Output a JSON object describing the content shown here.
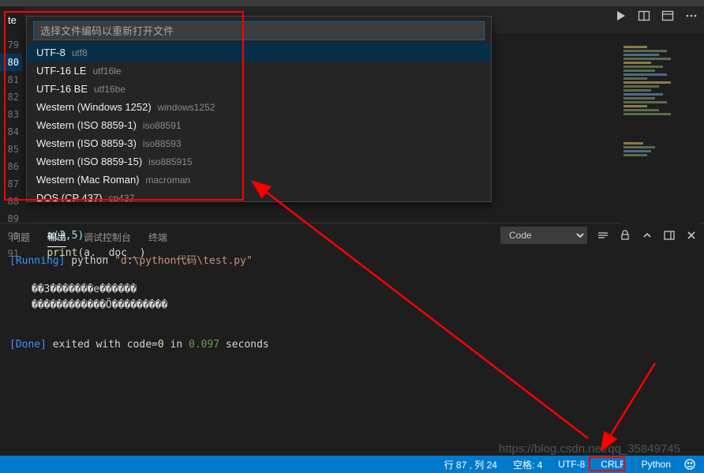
{
  "tab": {
    "label": "te"
  },
  "quick_input": {
    "placeholder": "选择文件编码以重新打开文件",
    "items": [
      {
        "label": "UTF-8",
        "sub": "utf8",
        "selected": true
      },
      {
        "label": "UTF-16 LE",
        "sub": "utf16le",
        "selected": false
      },
      {
        "label": "UTF-16 BE",
        "sub": "utf16be",
        "selected": false
      },
      {
        "label": "Western (Windows 1252)",
        "sub": "windows1252",
        "selected": false
      },
      {
        "label": "Western (ISO 8859-1)",
        "sub": "iso88591",
        "selected": false
      },
      {
        "label": "Western (ISO 8859-3)",
        "sub": "iso88593",
        "selected": false
      },
      {
        "label": "Western (ISO 8859-15)",
        "sub": "iso885915",
        "selected": false
      },
      {
        "label": "Western (Mac Roman)",
        "sub": "macroman",
        "selected": false
      },
      {
        "label": "DOS (CP 437)",
        "sub": "cp437",
        "selected": false
      }
    ]
  },
  "gutter": [
    "79",
    "80",
    "81",
    "82",
    "83",
    "84",
    "85",
    "86",
    "87",
    "88",
    "89",
    "90",
    "91"
  ],
  "code_line90": "a(3,5)",
  "code_line91_func": "print",
  "code_line91_rest": "(a.__doc__)",
  "panel": {
    "tabs": {
      "problems": "问题",
      "output": "输出",
      "debug": "调试控制台",
      "terminal": "终端"
    },
    "select": "Code",
    "run_prefix": "[Running]",
    "run_cmd": " python ",
    "run_path": "\"d:\\python代码\\test.py\"",
    "garbled1": "��3�������e������",
    "garbled2": "������������Ö���������",
    "done_prefix": "[Done]",
    "done_text1": " exited with code=",
    "done_code": "0",
    "done_text2": " in ",
    "done_time": "0.097",
    "done_text3": " seconds"
  },
  "statusbar": {
    "line_col": "行 87 , 列 24",
    "spaces": "空格: 4",
    "encoding": "UTF-8",
    "eol": "CRLF",
    "lang": "Python"
  },
  "watermark": "https://blog.csdn.net/qq_35849745"
}
